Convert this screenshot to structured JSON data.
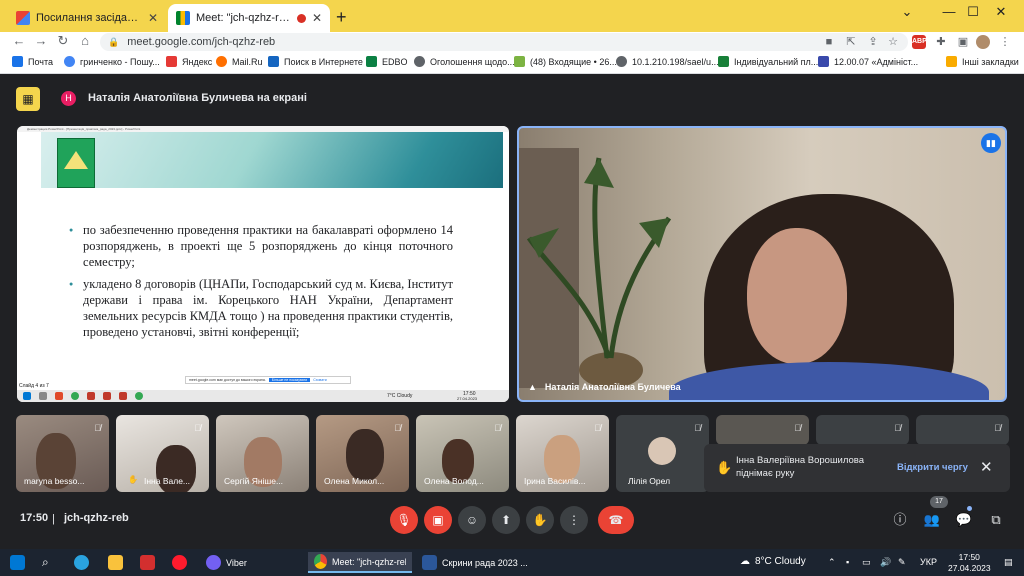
{
  "browser": {
    "tabs": [
      {
        "title": "Посилання засідання Ради робо",
        "active": false
      },
      {
        "title": "Meet: \"jch-qzhz-reb\"",
        "active": true
      }
    ],
    "url": "meet.google.com/jch-qzhz-reb",
    "bookmarks": [
      "Почта",
      "гринченко - Пошу...",
      "Яндекс",
      "Mail.Ru",
      "Поиск в Интернете",
      "EDBO",
      "Оголошення щодо...",
      "(48) Входящие • 26...",
      "10.1.210.198/sael/u...",
      "Індивідуальний пл...",
      "12.00.07 «Адмініст...",
      "Інші закладки"
    ],
    "adblock_label": "ABP"
  },
  "meet": {
    "presenter_initial": "Н",
    "presenter_text": "Наталія Анатоліївна Буличева на екрані",
    "speaker_name": "Наталія Анатоліївна Буличева",
    "slide": {
      "window_title": "Демонстрация PowerPoint - [Презентація_практика_рада_2023.pptx] - PowerPoint",
      "bullets": [
        "по забезпеченню проведення практики на бакалавраті оформлено 14 розпоряджень, в проекті ще 5 розпоряджень до кінця поточного семестру;",
        "укладено 8 договорів (ЦНАПи, Господарський суд м. Києва, Інститут держави і права ім. Корецького НАН України, Департамент земельних ресурсів КМДА тощо ) на проведення практики студентів, проведено установчі, звітні конференції;"
      ],
      "share_banner_text": "meet.google.com має доступ до вашого екрана.",
      "share_stop_label": "Більше не показувати",
      "share_hide_label": "Сховати",
      "mini_status": "Слайд 4 из 7",
      "mini_weather": "7°C Cloudy",
      "mini_time": "17:50",
      "mini_date": "27.04.2023"
    },
    "participants": [
      {
        "name": "maryna besso..."
      },
      {
        "name": "Інна Вале..."
      },
      {
        "name": "Сергій Яніше..."
      },
      {
        "name": "Олена Микол..."
      },
      {
        "name": "Олена Волод..."
      },
      {
        "name": "Ірина Василів..."
      },
      {
        "name": "Лілія Орел"
      },
      {
        "name": ""
      },
      {
        "name": ""
      },
      {
        "name": ""
      }
    ],
    "toast": {
      "message": "Інна Валеріївна Ворошилова піднімає руку",
      "action_label": "Відкрити чергу"
    },
    "time": "17:50",
    "separator": "|",
    "meeting_code": "jch-qzhz-reb",
    "participant_count": "17"
  },
  "taskbar": {
    "apps": [
      {
        "label": "Viber",
        "active": false
      },
      {
        "label": "Meet: \"jch-qzhz-reb...",
        "active": true
      },
      {
        "label": "Скрини рада 2023 ...",
        "active": false
      }
    ],
    "weather": "8°C Cloudy",
    "lang": "УКР",
    "time": "17:50",
    "date": "27.04.2023"
  },
  "colors": {
    "tab_strip": "#f4d54d",
    "meet_bg": "#202124",
    "accent": "#8ab4f8",
    "danger": "#ea4335"
  }
}
